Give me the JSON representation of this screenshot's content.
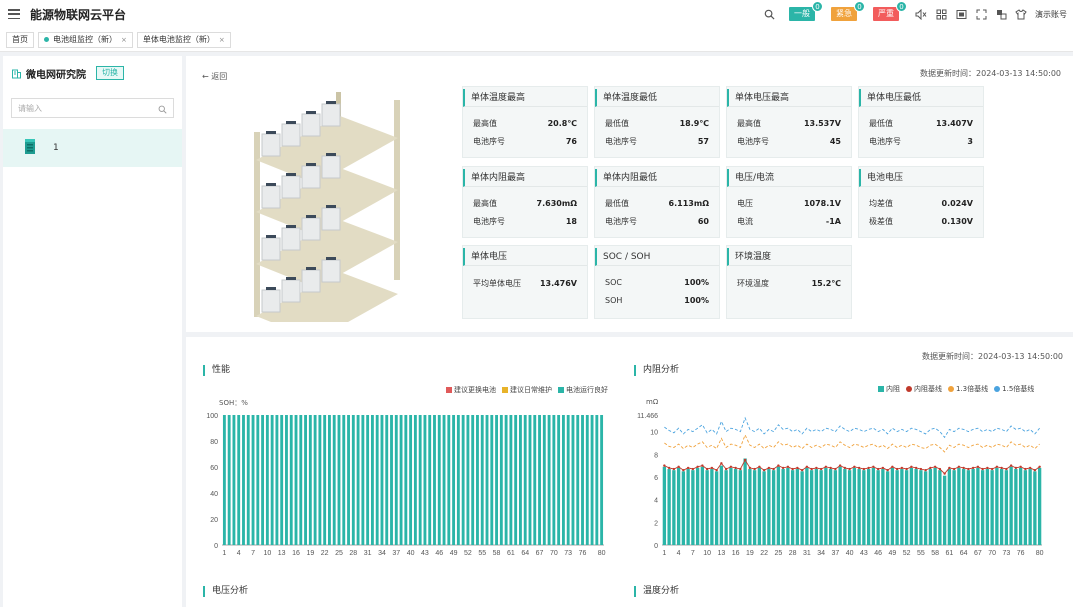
{
  "app": {
    "title": "能源物联网云平台"
  },
  "topbar": {
    "alerts": [
      {
        "label": "一般",
        "count": "0",
        "color": "#2bb5a8"
      },
      {
        "label": "紧急",
        "count": "0",
        "color": "#f0a23c"
      },
      {
        "label": "严重",
        "count": "0",
        "color": "#f25c5c"
      }
    ],
    "account": "演示账号"
  },
  "tabs": [
    {
      "label": "首页",
      "closable": false,
      "active": false
    },
    {
      "label": "电池组监控（新）",
      "closable": true,
      "active": true
    },
    {
      "label": "单体电池监控（新）",
      "closable": true,
      "active": false
    }
  ],
  "sidebar": {
    "title": "微电网研究院",
    "switch_label": "切换",
    "search_placeholder": "请输入",
    "item_label": "1"
  },
  "main": {
    "back_label": "返回",
    "update_time": "数据更新时间：2024-03-13 14:50:00",
    "cards": [
      {
        "title": "单体温度最高",
        "rows": [
          {
            "label": "最高值",
            "value": "20.8℃"
          },
          {
            "label": "电池序号",
            "value": "76"
          }
        ]
      },
      {
        "title": "单体温度最低",
        "rows": [
          {
            "label": "最低值",
            "value": "18.9℃"
          },
          {
            "label": "电池序号",
            "value": "57"
          }
        ]
      },
      {
        "title": "单体电压最高",
        "rows": [
          {
            "label": "最高值",
            "value": "13.537V"
          },
          {
            "label": "电池序号",
            "value": "45"
          }
        ]
      },
      {
        "title": "单体电压最低",
        "rows": [
          {
            "label": "最低值",
            "value": "13.407V"
          },
          {
            "label": "电池序号",
            "value": "3"
          }
        ]
      },
      {
        "title": "单体内阻最高",
        "rows": [
          {
            "label": "最高值",
            "value": "7.630mΩ"
          },
          {
            "label": "电池序号",
            "value": "18"
          }
        ]
      },
      {
        "title": "单体内阻最低",
        "rows": [
          {
            "label": "最低值",
            "value": "6.113mΩ"
          },
          {
            "label": "电池序号",
            "value": "60"
          }
        ]
      },
      {
        "title": "电压/电流",
        "rows": [
          {
            "label": "电压",
            "value": "1078.1V"
          },
          {
            "label": "电流",
            "value": "-1A"
          }
        ]
      },
      {
        "title": "电池电压",
        "rows": [
          {
            "label": "均差值",
            "value": "0.024V"
          },
          {
            "label": "极差值",
            "value": "0.130V"
          }
        ]
      },
      {
        "title": "单体电压",
        "rows": [
          {
            "label": "平均单体电压",
            "value": "13.476V"
          }
        ]
      },
      {
        "title": "SOC / SOH",
        "rows": [
          {
            "label": "SOC",
            "value": "100%"
          },
          {
            "label": "SOH",
            "value": "100%"
          }
        ]
      },
      {
        "title": "环境温度",
        "rows": [
          {
            "label": "环境温度",
            "value": "15.2℃"
          }
        ]
      }
    ]
  },
  "bottom": {
    "update_time": "数据更新时间：2024-03-13 14:50:00",
    "perf_title": "性能",
    "resist_title": "内阻分析",
    "voltage_title": "电压分析",
    "temp_title": "温度分析"
  },
  "chart_data": [
    {
      "type": "bar",
      "title": "性能",
      "ylabel": "SOH：%",
      "ylim": [
        0,
        100
      ],
      "yticks": [
        "0",
        "20",
        "40",
        "60",
        "80",
        "100"
      ],
      "xticks": [
        "1",
        "4",
        "7",
        "10",
        "13",
        "16",
        "19",
        "22",
        "25",
        "28",
        "31",
        "34",
        "37",
        "40",
        "43",
        "46",
        "49",
        "52",
        "55",
        "58",
        "61",
        "64",
        "67",
        "70",
        "73",
        "76",
        "80"
      ],
      "x_start": 1,
      "x_end": 80,
      "legend": [
        {
          "name": "建议更换电池",
          "color": "#e05a5a"
        },
        {
          "name": "建议日常维护",
          "color": "#e8b32a"
        },
        {
          "name": "电池运行良好",
          "color": "#2bb5a8"
        }
      ],
      "series": [
        {
          "name": "电池运行良好",
          "value_all": 100
        }
      ]
    },
    {
      "type": "bar",
      "title": "内阻分析",
      "ylabel": "mΩ",
      "ylim": [
        0,
        11.466
      ],
      "yticks": [
        "0",
        "2",
        "4",
        "6",
        "8",
        "10",
        "11.466"
      ],
      "xticks": [
        "1",
        "4",
        "7",
        "10",
        "13",
        "16",
        "19",
        "22",
        "25",
        "28",
        "31",
        "34",
        "37",
        "40",
        "43",
        "46",
        "49",
        "52",
        "55",
        "58",
        "61",
        "64",
        "67",
        "70",
        "73",
        "76",
        "80"
      ],
      "legend": [
        {
          "name": "内阻",
          "color": "#2bb5a8",
          "shape": "square"
        },
        {
          "name": "内阻基线",
          "color": "#c0392b",
          "shape": "dot"
        },
        {
          "name": "1.3倍基线",
          "color": "#f0a23c",
          "shape": "dot"
        },
        {
          "name": "1.5倍基线",
          "color": "#4aa3df",
          "shape": "dot"
        }
      ],
      "series": [
        {
          "name": "内阻",
          "values": [
            6.9,
            6.7,
            6.6,
            6.8,
            6.5,
            6.7,
            6.6,
            6.8,
            6.9,
            6.6,
            6.7,
            6.5,
            7.0,
            6.6,
            6.8,
            6.7,
            6.6,
            7.63,
            6.7,
            6.6,
            6.8,
            6.5,
            6.7,
            6.6,
            6.9,
            6.7,
            6.8,
            6.6,
            6.7,
            6.5,
            6.8,
            6.6,
            6.7,
            6.6,
            6.8,
            6.7,
            6.6,
            6.9,
            6.7,
            6.6,
            6.8,
            6.7,
            6.6,
            6.7,
            6.8,
            6.6,
            6.7,
            6.5,
            6.8,
            6.6,
            6.7,
            6.6,
            6.8,
            6.7,
            6.6,
            6.5,
            6.7,
            6.8,
            6.6,
            6.113,
            6.7,
            6.6,
            6.8,
            6.7,
            6.6,
            6.7,
            6.8,
            6.6,
            6.7,
            6.6,
            6.8,
            6.7,
            6.6,
            6.9,
            6.7,
            6.8,
            6.6,
            6.7,
            6.5,
            6.8
          ]
        },
        {
          "name": "内阻基线",
          "values": [
            7.0,
            6.8,
            6.7,
            6.9,
            6.6,
            6.8,
            6.7,
            6.9,
            7.0,
            6.7,
            6.8,
            6.6,
            7.2,
            6.7,
            6.9,
            6.8,
            6.7,
            7.5,
            6.8,
            6.7,
            6.9,
            6.6,
            6.8,
            6.7,
            7.0,
            6.8,
            6.9,
            6.7,
            6.8,
            6.6,
            6.9,
            6.7,
            6.8,
            6.7,
            6.9,
            6.8,
            6.7,
            7.0,
            6.8,
            6.7,
            6.9,
            6.8,
            6.7,
            6.8,
            6.9,
            6.7,
            6.8,
            6.6,
            6.9,
            6.7,
            6.8,
            6.7,
            6.9,
            6.8,
            6.7,
            6.6,
            6.8,
            6.9,
            6.7,
            6.3,
            6.8,
            6.7,
            6.9,
            6.8,
            6.7,
            6.8,
            6.9,
            6.7,
            6.8,
            6.7,
            6.9,
            6.8,
            6.7,
            7.0,
            6.8,
            6.9,
            6.7,
            6.8,
            6.6,
            6.9
          ]
        },
        {
          "name": "1.3倍基线",
          "values": [
            9.0,
            8.7,
            8.6,
            8.9,
            8.5,
            8.8,
            8.6,
            8.9,
            9.1,
            8.6,
            8.8,
            8.5,
            9.4,
            8.6,
            8.9,
            8.8,
            8.6,
            9.7,
            8.8,
            8.6,
            8.9,
            8.5,
            8.8,
            8.6,
            9.1,
            8.8,
            8.9,
            8.6,
            8.8,
            8.5,
            8.9,
            8.6,
            8.8,
            8.6,
            8.9,
            8.8,
            8.6,
            9.1,
            8.8,
            8.6,
            8.9,
            8.8,
            8.6,
            8.8,
            8.9,
            8.6,
            8.8,
            8.5,
            8.9,
            8.6,
            8.8,
            8.6,
            8.9,
            8.8,
            8.6,
            8.5,
            8.8,
            8.9,
            8.6,
            8.2,
            8.8,
            8.6,
            8.9,
            8.8,
            8.6,
            8.8,
            8.9,
            8.6,
            8.8,
            8.6,
            8.9,
            8.8,
            8.6,
            9.1,
            8.8,
            8.9,
            8.6,
            8.8,
            8.5,
            8.9
          ]
        },
        {
          "name": "1.5倍基线",
          "values": [
            10.4,
            10.1,
            9.9,
            10.3,
            9.8,
            10.2,
            10.0,
            10.3,
            10.6,
            9.9,
            10.2,
            9.8,
            10.9,
            10.0,
            10.3,
            10.2,
            10.0,
            11.2,
            10.2,
            10.0,
            10.3,
            9.8,
            10.2,
            10.0,
            10.6,
            10.2,
            10.3,
            10.0,
            10.2,
            9.8,
            10.3,
            10.0,
            10.2,
            10.0,
            10.3,
            10.2,
            10.0,
            10.5,
            10.2,
            10.0,
            10.3,
            10.2,
            10.0,
            10.2,
            10.3,
            10.0,
            10.2,
            9.8,
            10.3,
            10.0,
            10.2,
            10.0,
            10.3,
            10.2,
            10.0,
            9.8,
            10.2,
            10.3,
            10.0,
            9.5,
            10.2,
            10.0,
            10.3,
            10.2,
            10.0,
            10.2,
            10.3,
            10.0,
            10.2,
            10.0,
            10.3,
            10.2,
            10.0,
            10.5,
            10.2,
            10.3,
            10.0,
            10.2,
            9.8,
            10.3
          ]
        }
      ]
    }
  ]
}
